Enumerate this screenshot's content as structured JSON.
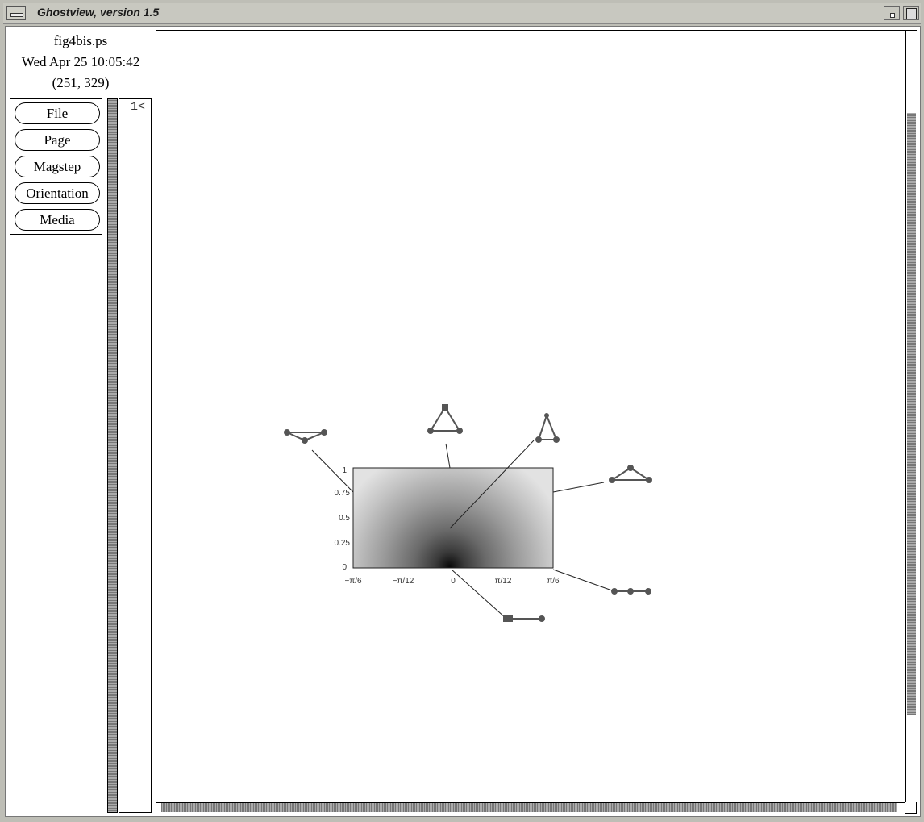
{
  "window": {
    "title": "Ghostview, version 1.5"
  },
  "info": {
    "filename": "fig4bis.ps",
    "date": "Wed Apr 25 10:05:42",
    "coords": "(251, 329)"
  },
  "menu_buttons": [
    "File",
    "Page",
    "Magstep",
    "Orientation",
    "Media"
  ],
  "page_list": {
    "current": "1<"
  },
  "figure": {
    "y_ticks": [
      "1",
      "0.75",
      "0.5",
      "0.25",
      "0"
    ],
    "x_ticks": [
      "−π/6",
      "−π/12",
      "0",
      "π/12",
      "π/6"
    ]
  },
  "colors": {
    "frame": "#bebeb6",
    "page_bg": "#ffffff"
  }
}
